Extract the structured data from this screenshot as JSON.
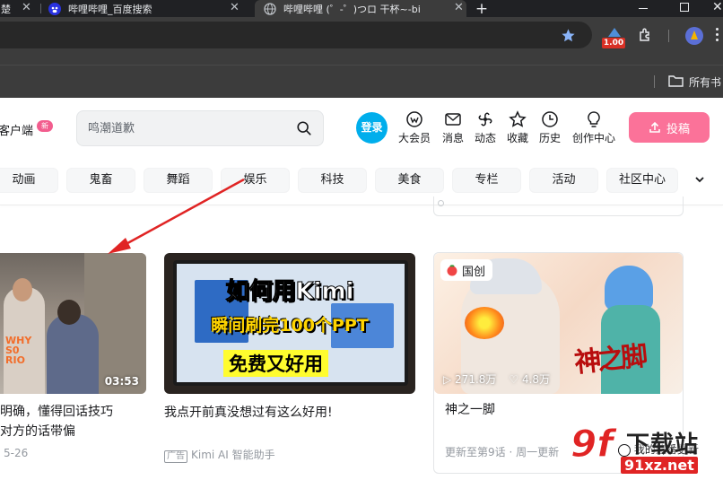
{
  "browser": {
    "tabs": [
      {
        "title": "楚",
        "active": false
      },
      {
        "title": "哔哩哔哩_百度搜索",
        "active": false
      },
      {
        "title": "哔哩哔哩 (゜-゜)つロ 干杯~-bi",
        "active": true
      }
    ],
    "new_tab_label": "+",
    "zoom_badge": "1.00",
    "bookmarks_folder": "所有书"
  },
  "header": {
    "client_label": "客户端",
    "new_badge": "新",
    "search_placeholder": "鸣潮道歉",
    "login_label": "登录",
    "nav": [
      {
        "icon": "vip-icon",
        "label": "大会员"
      },
      {
        "icon": "message-icon",
        "label": "消息"
      },
      {
        "icon": "dynamic-icon",
        "label": "动态"
      },
      {
        "icon": "favorite-icon",
        "label": "收藏"
      },
      {
        "icon": "history-icon",
        "label": "历史"
      },
      {
        "icon": "creator-icon",
        "label": "创作中心"
      }
    ],
    "upload_label": "投稿"
  },
  "channels": [
    "动画",
    "鬼畜",
    "舞蹈",
    "娱乐",
    "科技",
    "美食",
    "专栏",
    "活动",
    "社区中心"
  ],
  "cards": [
    {
      "duration": "03:53",
      "title_line1": "明确，懂得回话技巧",
      "title_line2": "对方的话带偏",
      "meta": "5-26"
    },
    {
      "overlay_line1": "如何用Kimi",
      "overlay_line2": "瞬间刷完100个PPT",
      "overlay_line3": "免费又好用",
      "title": "我点开前真没想过有这么好用!",
      "ad_tag": "广告",
      "meta": "Kimi AI 智能助手"
    },
    {
      "badge": "国创",
      "views": "271.8万",
      "likes": "4.8万",
      "title": "神之一脚",
      "meta": "更新至第9话 · 周一更新",
      "follow_text": "我的追番更新"
    }
  ],
  "watermark": {
    "brand": "下载站",
    "site": "91xz.net",
    "logo": "9f"
  },
  "colors": {
    "accent": "#00aeec",
    "pink": "#fb7299",
    "annotation": "#e02424"
  }
}
